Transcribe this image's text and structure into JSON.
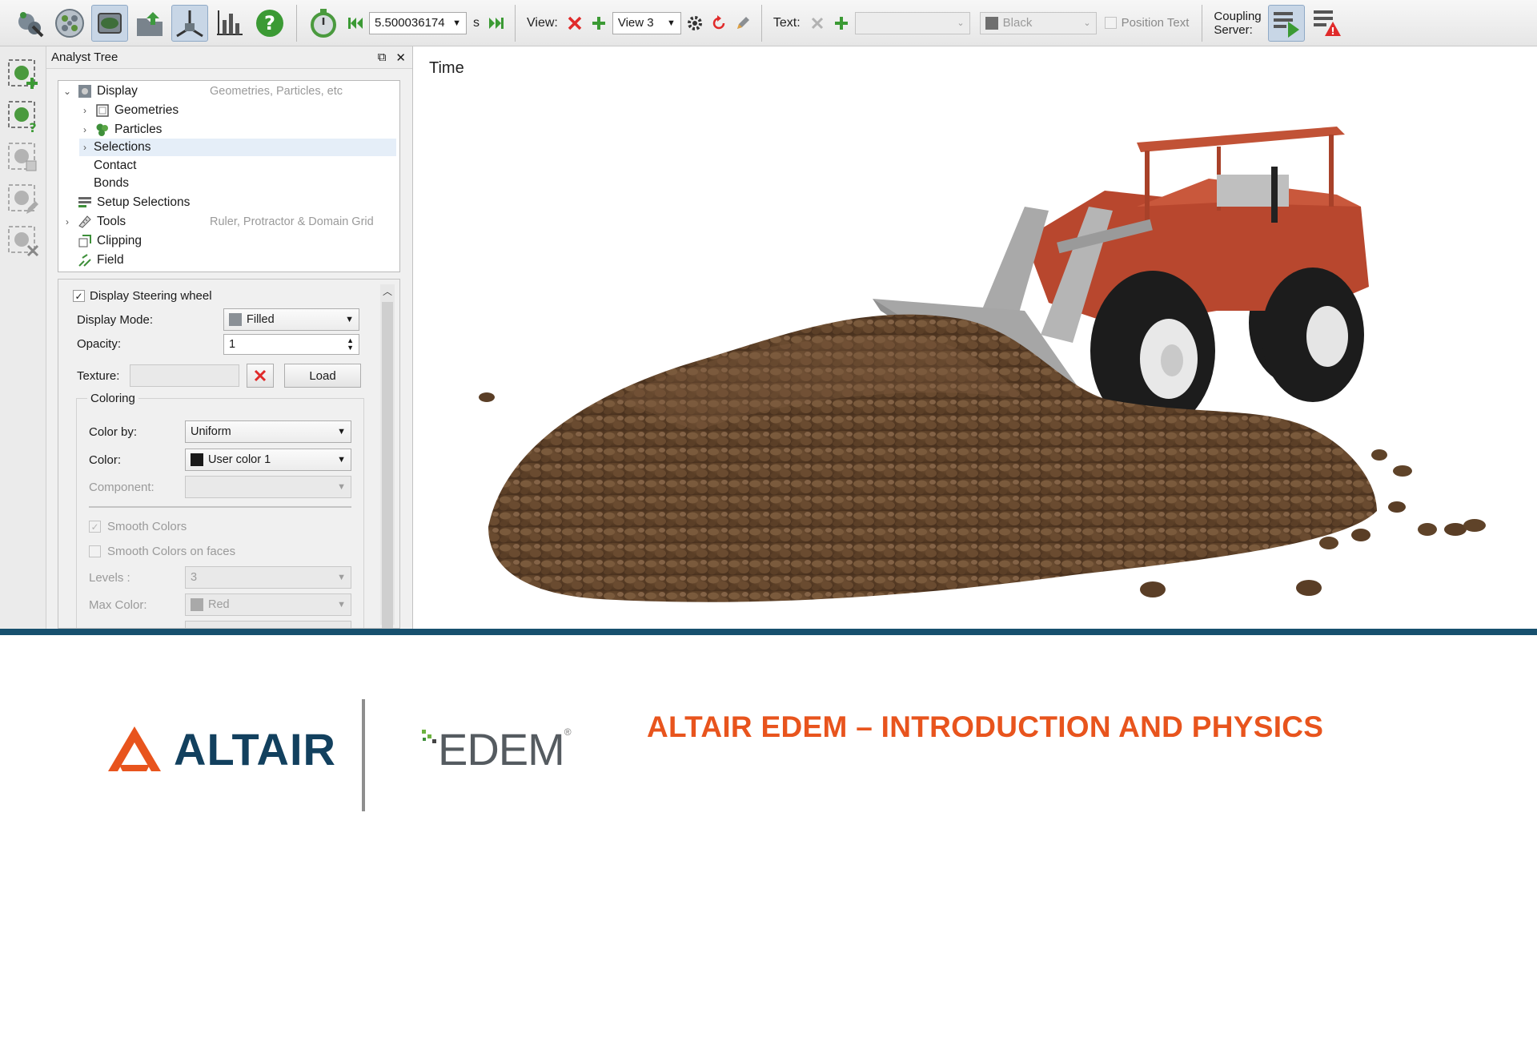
{
  "toolbar": {
    "time_value": "5.500036174",
    "time_unit": "s",
    "view_label": "View:",
    "view_selected": "View 3",
    "text_label": "Text:",
    "text_combo_value": "",
    "color_combo_value": "Black",
    "position_text_label": "Position Text",
    "coupling_label_line1": "Coupling",
    "coupling_label_line2": "Server:"
  },
  "panel": {
    "title": "Analyst Tree",
    "tree": [
      {
        "label": "Display",
        "hint": "Geometries, Particles, etc",
        "expander": "⌄"
      },
      {
        "label": "Geometries",
        "hint": "",
        "expander": "›"
      },
      {
        "label": "Particles",
        "hint": "",
        "expander": "›"
      },
      {
        "label": "Selections",
        "hint": "",
        "expander": "›"
      },
      {
        "label": "Contact",
        "hint": "",
        "expander": ""
      },
      {
        "label": "Bonds",
        "hint": "",
        "expander": ""
      },
      {
        "label": "Setup Selections",
        "hint": "",
        "expander": ""
      },
      {
        "label": "Tools",
        "hint": "Ruler, Protractor & Domain Grid",
        "expander": "›"
      },
      {
        "label": "Clipping",
        "hint": "",
        "expander": ""
      },
      {
        "label": "Field",
        "hint": "",
        "expander": ""
      }
    ],
    "props": {
      "display_checkbox_label": "Display Steering wheel",
      "display_mode_label": "Display Mode:",
      "display_mode_value": "Filled",
      "opacity_label": "Opacity:",
      "opacity_value": "1",
      "texture_label": "Texture:",
      "texture_value": "",
      "load_label": "Load",
      "coloring_group": "Coloring",
      "color_by_label": "Color by:",
      "color_by_value": "Uniform",
      "color_label": "Color:",
      "color_value": "User color 1",
      "color_swatch": "#1a1a1a",
      "component_label": "Component:",
      "component_value": "",
      "smooth_colors_label": "Smooth Colors",
      "smooth_faces_label": "Smooth Colors on faces",
      "levels_label": "Levels :",
      "levels_value": "3",
      "max_color_label": "Max Color:",
      "max_color_value": "Red",
      "max_color_swatch": "#a9a9a9"
    }
  },
  "viewport": {
    "time_label": "Time"
  },
  "banner": {
    "altair_word": "ALTAIR",
    "edem_word": "EDEM",
    "edem_reg": "®",
    "title": "ALTAIR EDEM – INTRODUCTION AND PHYSICS",
    "colors": {
      "altair_orange": "#e8541d",
      "altair_navy": "#12405e",
      "divider": "#17506e"
    }
  }
}
